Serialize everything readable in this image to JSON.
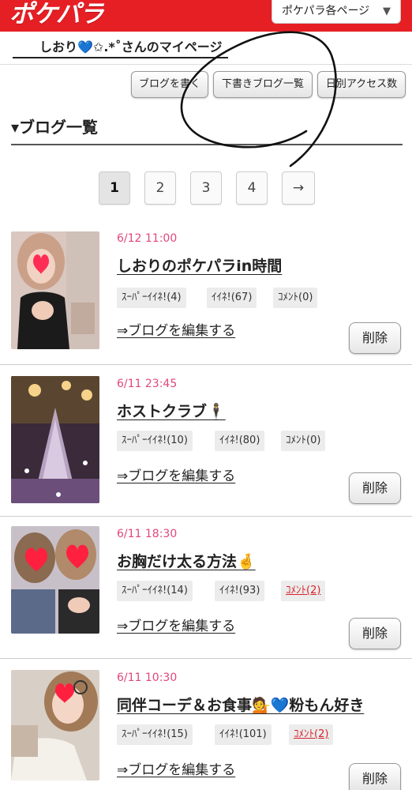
{
  "header": {
    "logo_text": "ポケパラ",
    "page_select_label": "ポケパラ各ページ",
    "page_select_caret": "▼",
    "brand_color": "#e51f24"
  },
  "mypage": {
    "title": "しおり💙✩.*˚さんのマイページ"
  },
  "actions": {
    "write_blog": "ブログを書く",
    "draft_list": "下書きブログ一覧",
    "daily_access": "日別アクセス数"
  },
  "section": {
    "heading": "▾ブログ一覧"
  },
  "pagination": {
    "pages": [
      "1",
      "2",
      "3",
      "4"
    ],
    "current": "1",
    "next": "→"
  },
  "entries": [
    {
      "date": "6/12 11:00",
      "title": "しおりのポケパラin時間",
      "super_like": "ｽｰﾊﾟｰｲｲﾈ!(4)",
      "like": "ｲｲﾈ!(67)",
      "comment": "ｺﾒﾝﾄ(0)",
      "edit": "⇒ブログを編集する",
      "delete": "削除"
    },
    {
      "date": "6/11 23:45",
      "title": "ホストクラブ🕴",
      "super_like": "ｽｰﾊﾟｰｲｲﾈ!(10)",
      "like": "ｲｲﾈ!(80)",
      "comment": "ｺﾒﾝﾄ(0)",
      "edit": "⇒ブログを編集する",
      "delete": "削除"
    },
    {
      "date": "6/11 18:30",
      "title": "お胸だけ太る方法🤞",
      "super_like": "ｽｰﾊﾟｰｲｲﾈ!(14)",
      "like": "ｲｲﾈ!(93)",
      "comment": "ｺﾒﾝﾄ(2)",
      "edit": "⇒ブログを編集する",
      "delete": "削除"
    },
    {
      "date": "6/11 10:30",
      "title": "同伴コーデ＆お食事💁💙粉もん好き",
      "super_like": "ｽｰﾊﾟｰｲｲﾈ!(15)",
      "like": "ｲｲﾈ!(101)",
      "comment": "ｺﾒﾝﾄ(2)",
      "edit": "⇒ブログを編集する",
      "delete": "削除"
    }
  ]
}
